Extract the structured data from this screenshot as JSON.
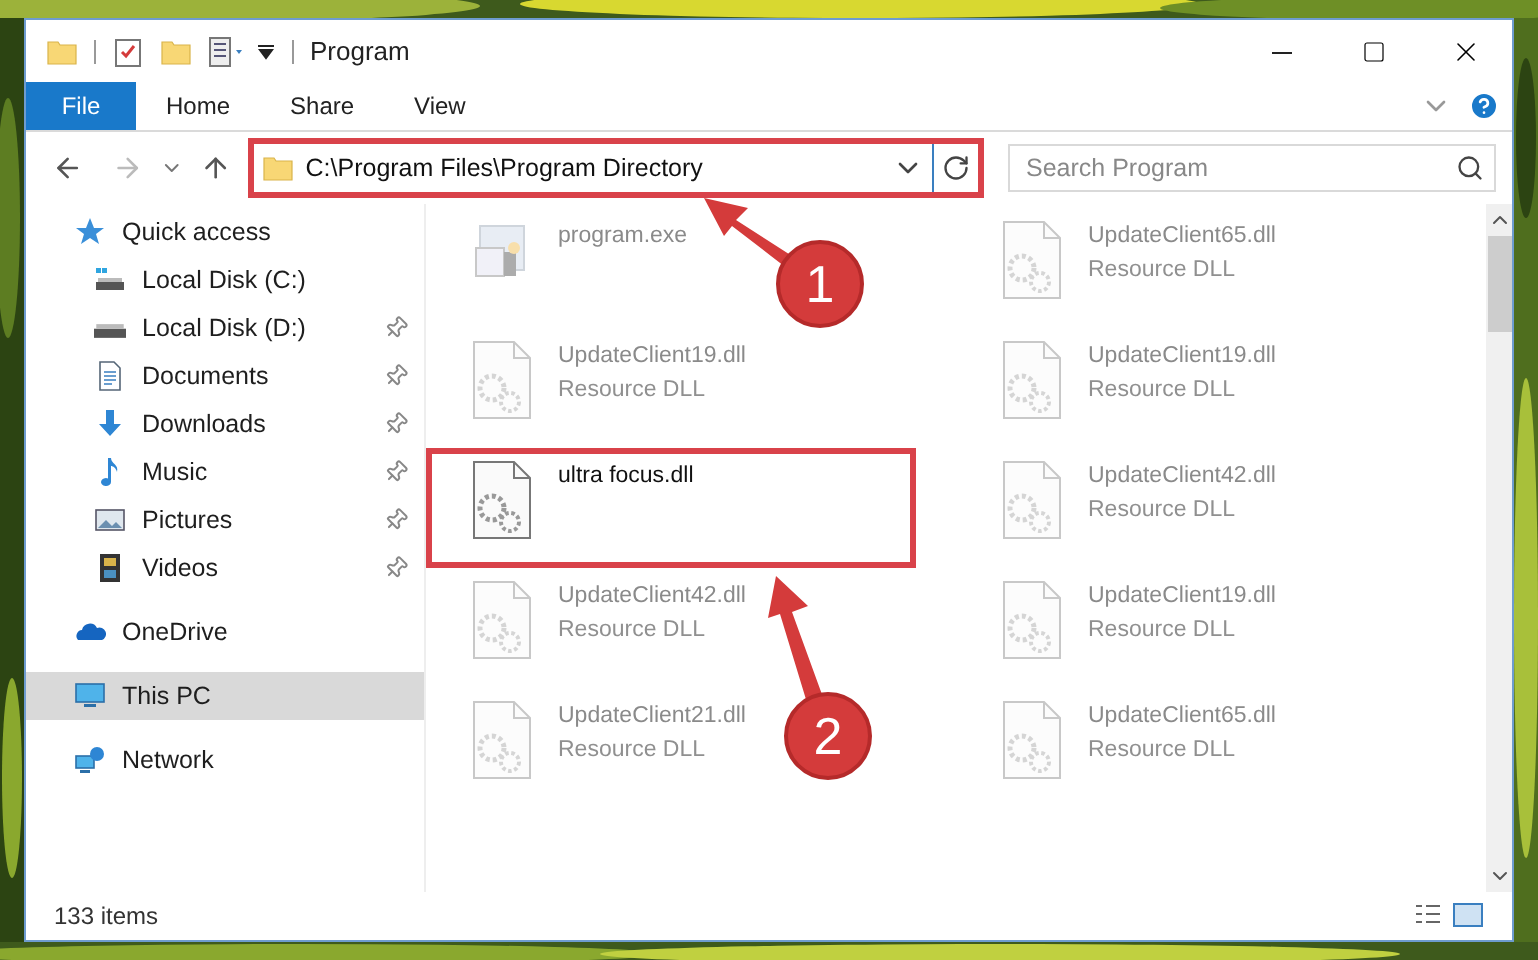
{
  "window": {
    "title": "Program"
  },
  "ribbon_tabs": [
    {
      "label": "File",
      "kind": "file"
    },
    {
      "label": "Home",
      "kind": "tab"
    },
    {
      "label": "Share",
      "kind": "tab"
    },
    {
      "label": "View",
      "kind": "tab"
    }
  ],
  "address": {
    "value": "C:\\Program Files\\Program Directory",
    "highlighted": true
  },
  "search": {
    "placeholder": "Search Program"
  },
  "sidebar": {
    "items": [
      {
        "label": "Quick access",
        "kind": "star",
        "selected": false,
        "children": [
          {
            "label": "Local Disk (C:)",
            "kind": "system-drive",
            "pinned": false,
            "selected": false
          },
          {
            "label": "Local Disk (D:)",
            "kind": "drive",
            "pinned": true,
            "selected": false
          },
          {
            "label": "Documents",
            "kind": "documents",
            "pinned": true,
            "selected": false
          },
          {
            "label": "Downloads",
            "kind": "downloads",
            "pinned": true,
            "selected": false
          },
          {
            "label": "Music",
            "kind": "music",
            "pinned": true,
            "selected": false
          },
          {
            "label": "Pictures",
            "kind": "pictures",
            "pinned": true,
            "selected": false
          },
          {
            "label": "Videos",
            "kind": "videos",
            "pinned": true,
            "selected": false
          }
        ]
      },
      {
        "label": "OneDrive",
        "kind": "cloud",
        "selected": false
      },
      {
        "label": "This PC",
        "kind": "pc",
        "selected": true
      },
      {
        "label": "Network",
        "kind": "network",
        "selected": false
      }
    ]
  },
  "files": [
    {
      "name": "program.exe",
      "kind": "exe",
      "faded": true,
      "highlighted": false
    },
    {
      "name": "UpdateClient65.dll",
      "type": "Resource DLL",
      "kind": "dll",
      "faded": true,
      "highlighted": false
    },
    {
      "name": "UpdateClient19.dll",
      "type": "Resource DLL",
      "kind": "dll",
      "faded": true,
      "highlighted": false
    },
    {
      "name": "UpdateClient19.dll",
      "type": "Resource DLL",
      "kind": "dll",
      "faded": true,
      "highlighted": false
    },
    {
      "name": "ultra focus.dll",
      "kind": "dll",
      "faded": false,
      "highlighted": true
    },
    {
      "name": "UpdateClient42.dll",
      "type": "Resource DLL",
      "kind": "dll",
      "faded": true,
      "highlighted": false
    },
    {
      "name": "UpdateClient42.dll",
      "type": "Resource DLL",
      "kind": "dll",
      "faded": true,
      "highlighted": false
    },
    {
      "name": "UpdateClient19.dll",
      "type": "Resource DLL",
      "kind": "dll",
      "faded": true,
      "highlighted": false
    },
    {
      "name": "UpdateClient21.dll",
      "type": "Resource DLL",
      "kind": "dll",
      "faded": true,
      "highlighted": false
    },
    {
      "name": "UpdateClient65.dll",
      "type": "Resource DLL",
      "kind": "dll",
      "faded": true,
      "highlighted": false
    }
  ],
  "annotations": [
    {
      "label": "1"
    },
    {
      "label": "2"
    }
  ],
  "status_bar": {
    "count": "133 items"
  }
}
